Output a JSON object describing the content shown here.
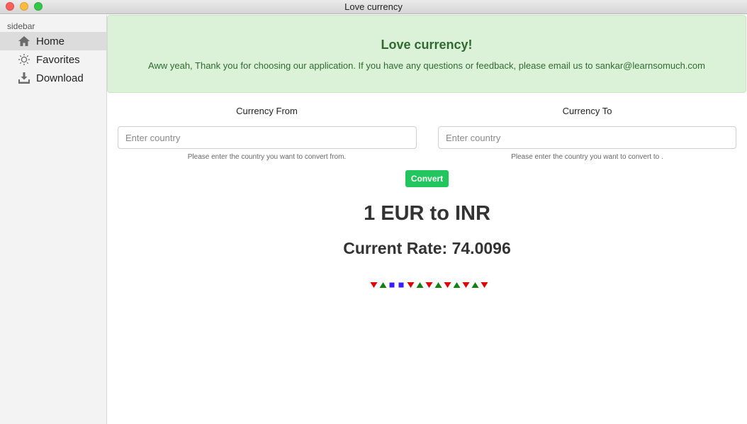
{
  "window": {
    "title": "Love currency"
  },
  "sidebar": {
    "heading": "sidebar",
    "items": [
      {
        "label": "Home",
        "icon": "home-icon",
        "active": true
      },
      {
        "label": "Favorites",
        "icon": "sun-icon",
        "active": false
      },
      {
        "label": "Download",
        "icon": "download-icon",
        "active": false
      }
    ]
  },
  "banner": {
    "title": "Love currency!",
    "message": "Aww yeah, Thank you for choosing our application. If you have any questions or feedback, please email us to sankar@learnsomuch.com"
  },
  "form": {
    "from": {
      "label": "Currency From",
      "placeholder": "Enter country",
      "value": "",
      "help": "Please enter the country you want to convert from."
    },
    "to": {
      "label": "Currency To",
      "placeholder": "Enter country",
      "value": "",
      "help": "Please enter the country you want to convert to ."
    },
    "convert_label": "Convert"
  },
  "result": {
    "pair": "1 EUR to INR",
    "rate": "Current Rate: 74.0096"
  },
  "trend": {
    "colors": {
      "down": "#e00000",
      "up": "#128012",
      "flat": "#3a1aff"
    },
    "marks": [
      "down",
      "up",
      "flat",
      "flat",
      "down",
      "up",
      "down",
      "up",
      "down",
      "up",
      "down",
      "up",
      "down"
    ]
  }
}
